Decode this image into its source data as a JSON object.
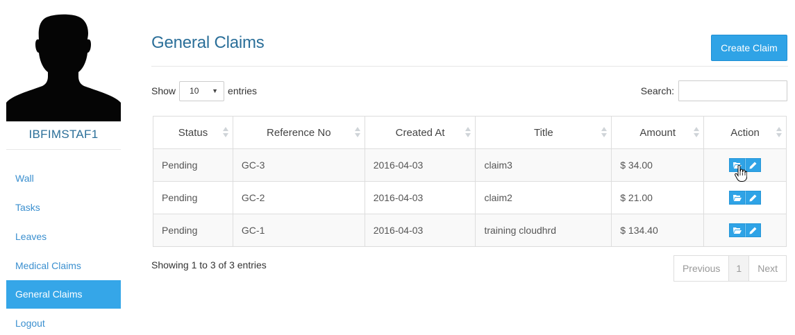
{
  "sidebar": {
    "username": "IBFIMSTAF1",
    "items": [
      {
        "label": "Wall"
      },
      {
        "label": "Tasks"
      },
      {
        "label": "Leaves"
      },
      {
        "label": "Medical Claims"
      },
      {
        "label": "General Claims",
        "active": true
      },
      {
        "label": "Logout"
      }
    ]
  },
  "header": {
    "title": "General Claims",
    "create_button": "Create Claim"
  },
  "controls": {
    "show_label": "Show",
    "entries_value": "10",
    "entries_label": "entries",
    "search_label": "Search:",
    "search_value": ""
  },
  "table": {
    "columns": [
      "Status",
      "Reference No",
      "Created At",
      "Title",
      "Amount",
      "Action"
    ],
    "rows": [
      {
        "status": "Pending",
        "ref": "GC-3",
        "created": "2016-04-03",
        "title": "claim3",
        "amount": "$ 34.00"
      },
      {
        "status": "Pending",
        "ref": "GC-2",
        "created": "2016-04-03",
        "title": "claim2",
        "amount": "$ 21.00"
      },
      {
        "status": "Pending",
        "ref": "GC-1",
        "created": "2016-04-03",
        "title": "training cloudhrd",
        "amount": "$ 134.40"
      }
    ]
  },
  "footer": {
    "info": "Showing 1 to 3 of 3 entries",
    "prev": "Previous",
    "page": "1",
    "next": "Next"
  },
  "icons": {
    "view": "folder-open-icon",
    "edit": "pencil-icon"
  },
  "colors": {
    "accent": "#2fa3e6",
    "title": "#2b6f99",
    "link": "#3a8fcf"
  }
}
